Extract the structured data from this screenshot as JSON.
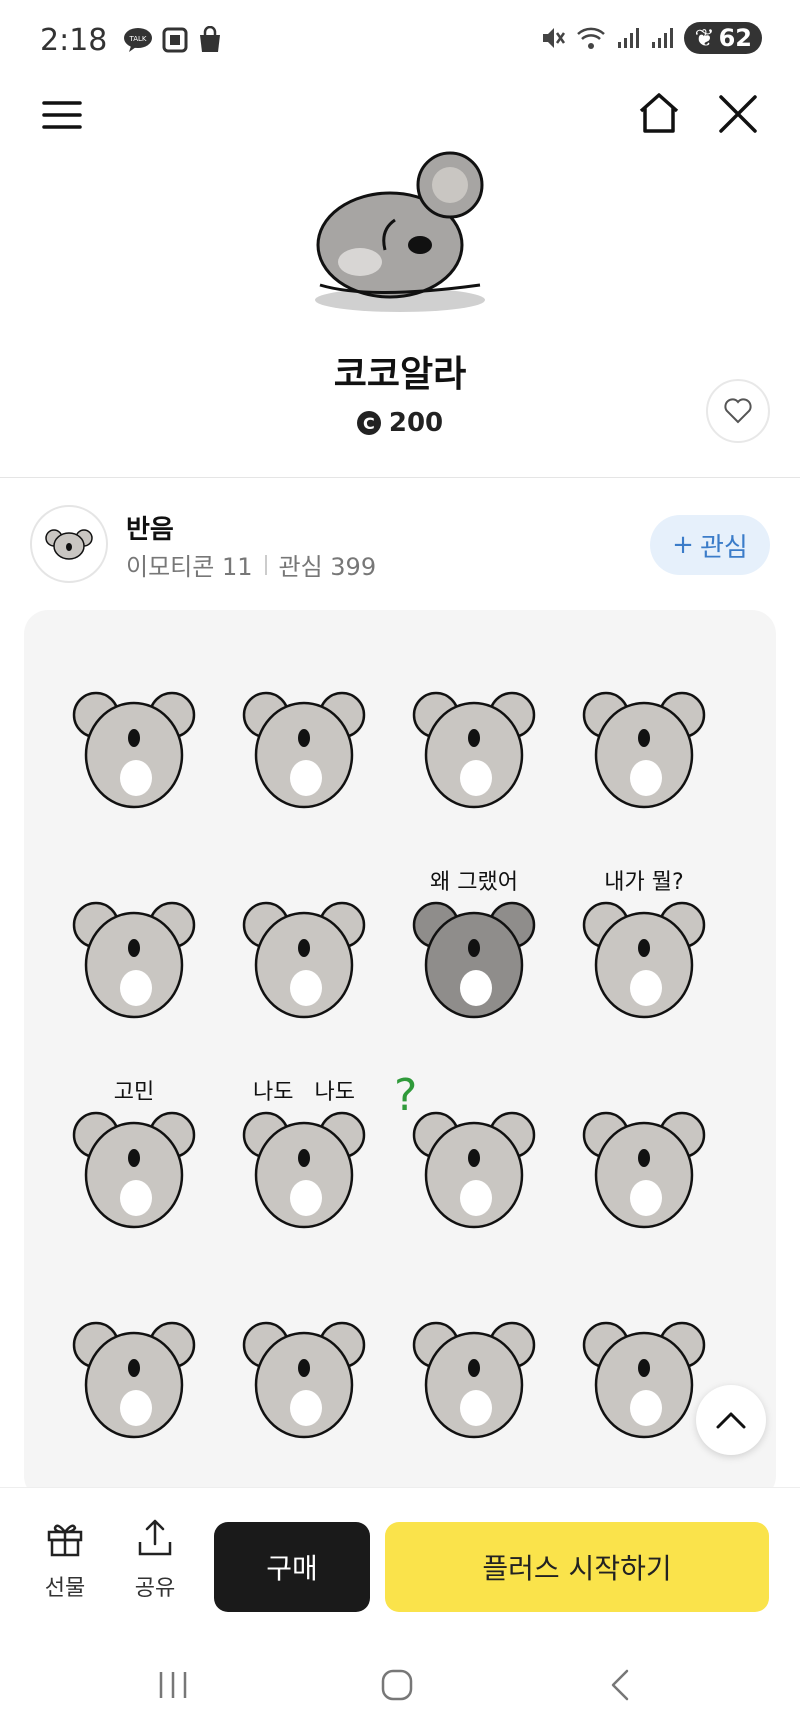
{
  "status_bar": {
    "time": "2:18",
    "battery": "62"
  },
  "product": {
    "title": "코코알라",
    "price": "200",
    "coin_symbol": "C"
  },
  "artist": {
    "name": "반음",
    "emoticon_count": "이모티콘 11",
    "likes": "관심 399",
    "follow_label": "관심",
    "follow_prefix": "+"
  },
  "stickers": [
    {
      "caption": ""
    },
    {
      "caption": ""
    },
    {
      "caption": ""
    },
    {
      "caption": ""
    },
    {
      "caption": ""
    },
    {
      "caption": ""
    },
    {
      "caption": "왜 그랬어"
    },
    {
      "caption": "내가 뭘?"
    },
    {
      "caption": "고민"
    },
    {
      "caption": "나도   나도"
    },
    {
      "caption": "?"
    },
    {
      "caption": ""
    },
    {
      "caption": ""
    },
    {
      "caption": ""
    },
    {
      "caption": ""
    },
    {
      "caption": ""
    }
  ],
  "bottom_bar": {
    "gift_label": "선물",
    "share_label": "공유",
    "buy_label": "구매",
    "plus_label": "플러스 시작하기"
  },
  "colors": {
    "accent_yellow": "#fae34b",
    "follow_blue": "#3b7cc9",
    "koala_gray": "#c9c6c2"
  }
}
